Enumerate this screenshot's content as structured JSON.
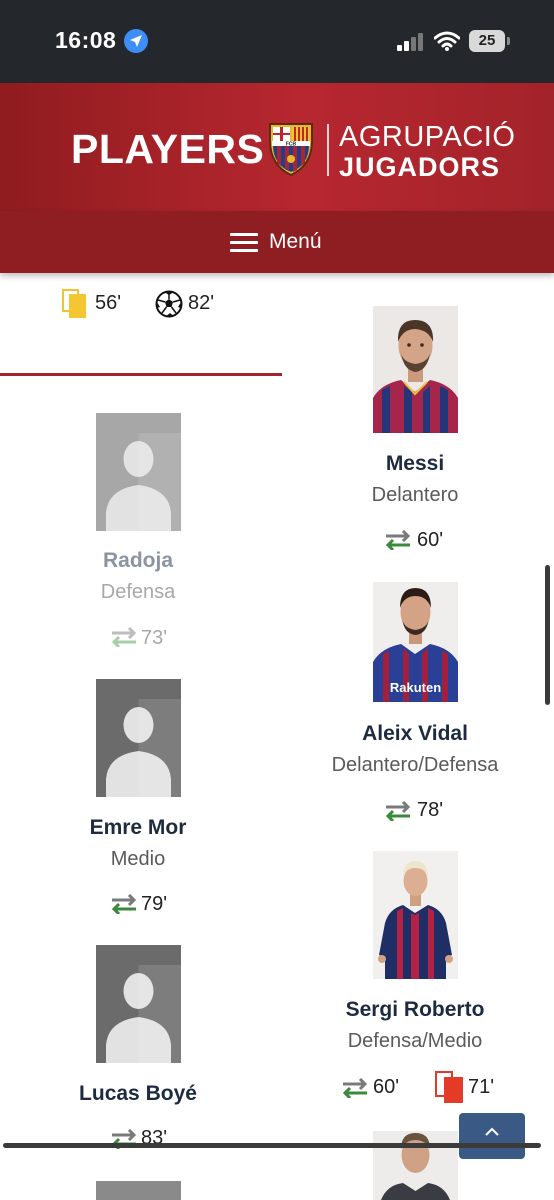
{
  "status_bar": {
    "time": "16:08",
    "battery": "25"
  },
  "header": {
    "logo_left": "PLAYERS",
    "logo_right_top": "AGRUPACIÓ",
    "logo_right_bottom": "JUGADORS",
    "crest_text": "FCB",
    "menu_label": "Menú"
  },
  "top_stats": {
    "yellow_card": "56'",
    "goal": "82'"
  },
  "left_players": [
    {
      "name": "Radoja",
      "position": "Defensa",
      "sub": "73'"
    },
    {
      "name": "Emre Mor",
      "position": "Medio",
      "sub": "79'"
    },
    {
      "name": "Lucas Boyé",
      "sub": "83'"
    }
  ],
  "right_players": [
    {
      "name": "Messi",
      "position": "Delantero",
      "sub": "60'"
    },
    {
      "name": "Aleix Vidal",
      "position": "Delantero/Defensa",
      "sub": "78'"
    },
    {
      "name": "Sergi Roberto",
      "position": "Defensa/Medio",
      "sub": "60'",
      "red_card": "71'"
    }
  ],
  "jersey_sponsor": "Rakuten",
  "colors": {
    "brand_red": "#a6232b",
    "menu_red": "#8e1e21",
    "name_navy": "#1d2a40",
    "sub_green": "#3a8a3c",
    "sub_red": "#c0392b"
  }
}
